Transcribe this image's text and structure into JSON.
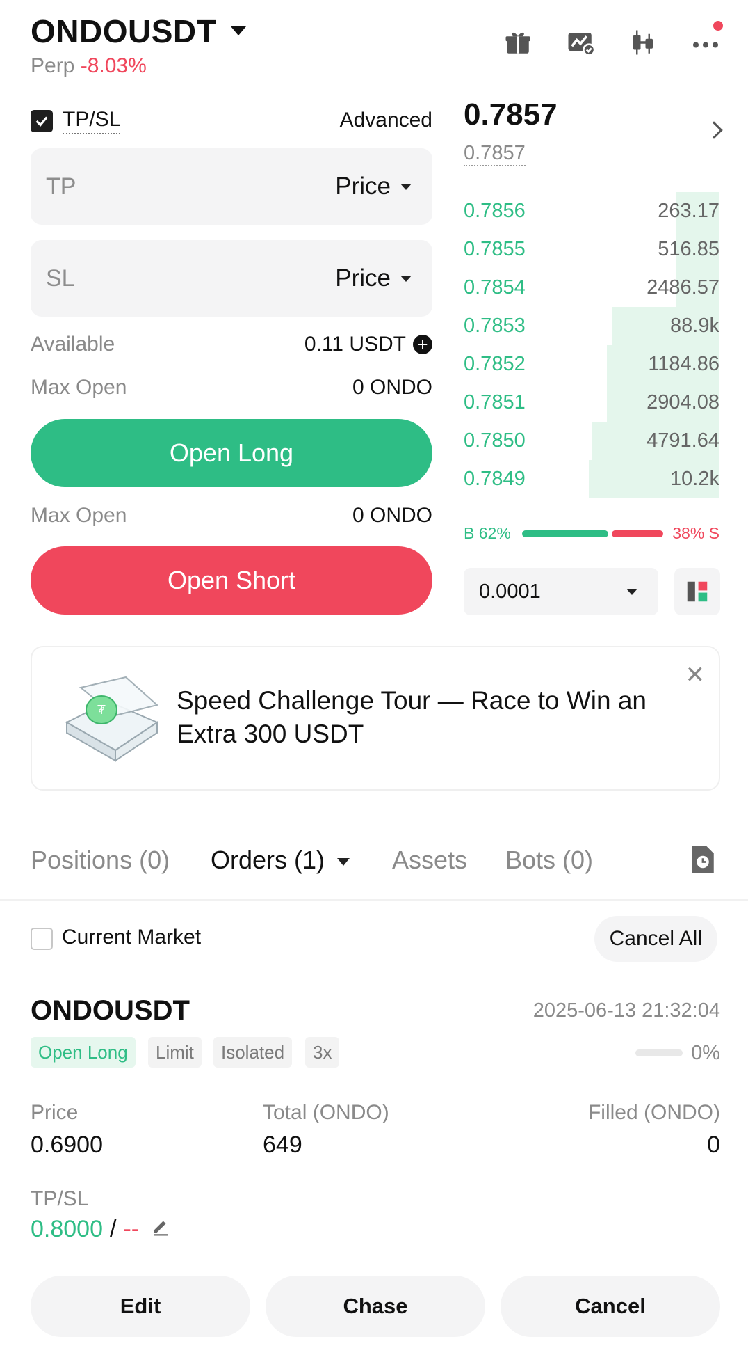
{
  "header": {
    "symbol": "ONDOUSDT",
    "type_label": "Perp",
    "change": "-8.03%",
    "icons": [
      "gift-icon",
      "chart-check-icon",
      "candlestick-icon",
      "more-icon"
    ]
  },
  "form": {
    "tpsl_label": "TP/SL",
    "tpsl_checked": true,
    "advanced_label": "Advanced",
    "tp_placeholder": "TP",
    "tp_type": "Price",
    "sl_placeholder": "SL",
    "sl_type": "Price",
    "available_label": "Available",
    "available_value": "0.11 USDT",
    "max_open_label": "Max Open",
    "max_open_long": "0 ONDO",
    "open_long_label": "Open Long",
    "max_open_short": "0 ONDO",
    "open_short_label": "Open Short"
  },
  "orderbook": {
    "last_price": "0.7857",
    "mark_price": "0.7857",
    "rows": [
      {
        "price": "0.7856",
        "qty": "263.17",
        "depth": 0.17
      },
      {
        "price": "0.7855",
        "qty": "516.85",
        "depth": 0.17
      },
      {
        "price": "0.7854",
        "qty": "2486.57",
        "depth": 0.17
      },
      {
        "price": "0.7853",
        "qty": "88.9k",
        "depth": 0.42
      },
      {
        "price": "0.7852",
        "qty": "1184.86",
        "depth": 0.44
      },
      {
        "price": "0.7851",
        "qty": "2904.08",
        "depth": 0.44
      },
      {
        "price": "0.7850",
        "qty": "4791.64",
        "depth": 0.5
      },
      {
        "price": "0.7849",
        "qty": "10.2k",
        "depth": 0.51
      }
    ],
    "buy_ratio": "B 62%",
    "sell_ratio": "38% S",
    "precision": "0.0001"
  },
  "banner": {
    "text": "Speed Challenge Tour — Race to Win an Extra 300 USDT"
  },
  "tabs": [
    {
      "label": "Positions (0)"
    },
    {
      "label": "Orders (1)"
    },
    {
      "label": "Assets"
    },
    {
      "label": "Bots (0)"
    }
  ],
  "orders": {
    "current_market_label": "Current Market",
    "cancel_all_label": "Cancel All",
    "symbol": "ONDOUSDT",
    "time": "2025-06-13 21:32:04",
    "tags": [
      "Open Long",
      "Limit",
      "Isolated",
      "3x"
    ],
    "filled_pct": "0%",
    "price_label": "Price",
    "price_value": "0.6900",
    "total_label": "Total (ONDO)",
    "total_value": "649",
    "filled_label": "Filled (ONDO)",
    "filled_value": "0",
    "tpsl_label": "TP/SL",
    "tp_value": "0.8000",
    "separator": "/",
    "sl_value": "--",
    "edit_label": "Edit",
    "chase_label": "Chase",
    "cancel_label": "Cancel"
  },
  "colors": {
    "buy": "#2ebd85",
    "sell": "#f0475c"
  }
}
